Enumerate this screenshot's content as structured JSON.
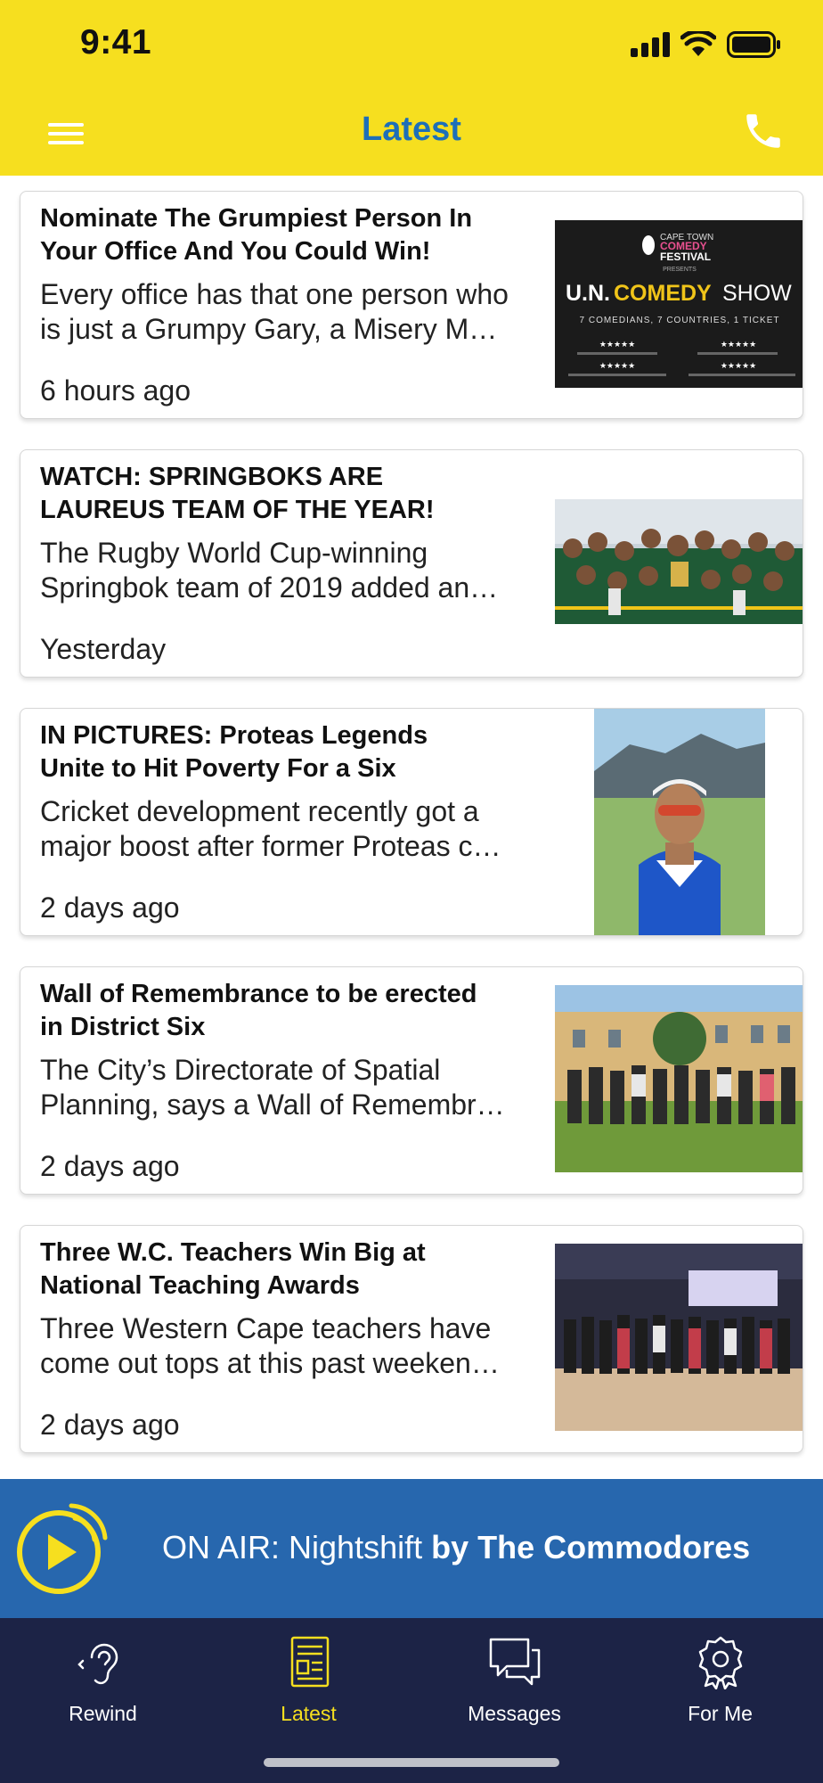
{
  "status_bar": {
    "time": "9:41"
  },
  "header": {
    "title": "Latest",
    "background": "#f6df1f",
    "title_color": "#1d6fb8"
  },
  "articles": [
    {
      "headline_lines": [
        "Nominate The Grumpiest Person In",
        "Your Office And You Could Win!"
      ],
      "summary_lines": [
        "Every office has that one person who",
        "is just a Grumpy Gary, a Misery M…"
      ],
      "time": "6 hours ago",
      "image": {
        "festival_line1": "CAPE TOWN",
        "festival_line2": "COMEDY",
        "festival_line3": "FESTIVAL",
        "presents": "PRESENTS",
        "show_prefix": "U.N.",
        "show_comedy": "COMEDY",
        "show_suffix": "SHOW",
        "tagline": "7 COMEDIANS, 7 COUNTRIES, 1 TICKET",
        "stars": "★★★★★"
      }
    },
    {
      "headline_lines": [
        "WATCH: SPRINGBOKS ARE",
        "LAUREUS TEAM OF THE YEAR!"
      ],
      "summary_lines": [
        "The Rugby World Cup-winning",
        "Springbok team of 2019 added an…"
      ],
      "time": "Yesterday"
    },
    {
      "headline_lines": [
        "IN PICTURES: Proteas Legends",
        "Unite to Hit Poverty For a Six"
      ],
      "summary_lines": [
        "Cricket development recently got a",
        "major boost after former Proteas c…"
      ],
      "time": "2 days ago"
    },
    {
      "headline_lines": [
        "Wall of Remembrance to be erected",
        "in District Six"
      ],
      "summary_lines": [
        "The City’s Directorate of Spatial",
        "Planning, says a Wall of Remembr…"
      ],
      "time": "2 days ago"
    },
    {
      "headline_lines": [
        "Three W.C. Teachers Win Big at",
        "National Teaching Awards"
      ],
      "summary_lines": [
        "Three Western Cape teachers have",
        "come out tops at this past weeken…"
      ],
      "time": "2 days ago"
    }
  ],
  "on_air": {
    "prefix": "ON AIR: Nightshift",
    "artist": "by The Commodores",
    "background": "#2767ae"
  },
  "tabs": [
    {
      "label": "Rewind",
      "icon": "ear-icon"
    },
    {
      "label": "Latest",
      "icon": "newspaper-icon",
      "active": true
    },
    {
      "label": "Messages",
      "icon": "chat-bubbles-icon"
    },
    {
      "label": "For Me",
      "icon": "badge-icon"
    }
  ],
  "colors": {
    "accent_yellow": "#f6df1f",
    "brand_blue": "#2767ae",
    "tabbar_navy": "#1c2346"
  }
}
